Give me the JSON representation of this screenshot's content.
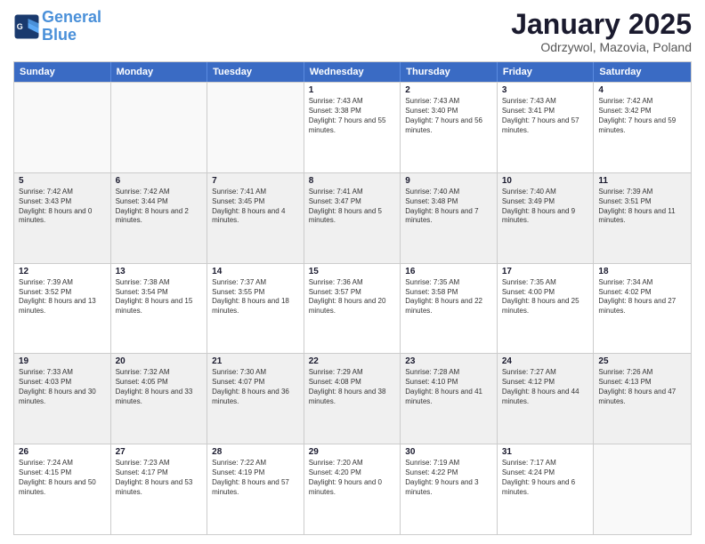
{
  "header": {
    "logo_line1": "General",
    "logo_line2": "Blue",
    "month_title": "January 2025",
    "location": "Odrzywol, Mazovia, Poland"
  },
  "days_of_week": [
    "Sunday",
    "Monday",
    "Tuesday",
    "Wednesday",
    "Thursday",
    "Friday",
    "Saturday"
  ],
  "rows": [
    [
      {
        "day": "",
        "empty": true
      },
      {
        "day": "",
        "empty": true
      },
      {
        "day": "",
        "empty": true
      },
      {
        "day": "1",
        "sunrise": "7:43 AM",
        "sunset": "3:38 PM",
        "daylight": "7 hours and 55 minutes."
      },
      {
        "day": "2",
        "sunrise": "7:43 AM",
        "sunset": "3:40 PM",
        "daylight": "7 hours and 56 minutes."
      },
      {
        "day": "3",
        "sunrise": "7:43 AM",
        "sunset": "3:41 PM",
        "daylight": "7 hours and 57 minutes."
      },
      {
        "day": "4",
        "sunrise": "7:42 AM",
        "sunset": "3:42 PM",
        "daylight": "7 hours and 59 minutes."
      }
    ],
    [
      {
        "day": "5",
        "sunrise": "7:42 AM",
        "sunset": "3:43 PM",
        "daylight": "8 hours and 0 minutes."
      },
      {
        "day": "6",
        "sunrise": "7:42 AM",
        "sunset": "3:44 PM",
        "daylight": "8 hours and 2 minutes."
      },
      {
        "day": "7",
        "sunrise": "7:41 AM",
        "sunset": "3:45 PM",
        "daylight": "8 hours and 4 minutes."
      },
      {
        "day": "8",
        "sunrise": "7:41 AM",
        "sunset": "3:47 PM",
        "daylight": "8 hours and 5 minutes."
      },
      {
        "day": "9",
        "sunrise": "7:40 AM",
        "sunset": "3:48 PM",
        "daylight": "8 hours and 7 minutes."
      },
      {
        "day": "10",
        "sunrise": "7:40 AM",
        "sunset": "3:49 PM",
        "daylight": "8 hours and 9 minutes."
      },
      {
        "day": "11",
        "sunrise": "7:39 AM",
        "sunset": "3:51 PM",
        "daylight": "8 hours and 11 minutes."
      }
    ],
    [
      {
        "day": "12",
        "sunrise": "7:39 AM",
        "sunset": "3:52 PM",
        "daylight": "8 hours and 13 minutes."
      },
      {
        "day": "13",
        "sunrise": "7:38 AM",
        "sunset": "3:54 PM",
        "daylight": "8 hours and 15 minutes."
      },
      {
        "day": "14",
        "sunrise": "7:37 AM",
        "sunset": "3:55 PM",
        "daylight": "8 hours and 18 minutes."
      },
      {
        "day": "15",
        "sunrise": "7:36 AM",
        "sunset": "3:57 PM",
        "daylight": "8 hours and 20 minutes."
      },
      {
        "day": "16",
        "sunrise": "7:35 AM",
        "sunset": "3:58 PM",
        "daylight": "8 hours and 22 minutes."
      },
      {
        "day": "17",
        "sunrise": "7:35 AM",
        "sunset": "4:00 PM",
        "daylight": "8 hours and 25 minutes."
      },
      {
        "day": "18",
        "sunrise": "7:34 AM",
        "sunset": "4:02 PM",
        "daylight": "8 hours and 27 minutes."
      }
    ],
    [
      {
        "day": "19",
        "sunrise": "7:33 AM",
        "sunset": "4:03 PM",
        "daylight": "8 hours and 30 minutes."
      },
      {
        "day": "20",
        "sunrise": "7:32 AM",
        "sunset": "4:05 PM",
        "daylight": "8 hours and 33 minutes."
      },
      {
        "day": "21",
        "sunrise": "7:30 AM",
        "sunset": "4:07 PM",
        "daylight": "8 hours and 36 minutes."
      },
      {
        "day": "22",
        "sunrise": "7:29 AM",
        "sunset": "4:08 PM",
        "daylight": "8 hours and 38 minutes."
      },
      {
        "day": "23",
        "sunrise": "7:28 AM",
        "sunset": "4:10 PM",
        "daylight": "8 hours and 41 minutes."
      },
      {
        "day": "24",
        "sunrise": "7:27 AM",
        "sunset": "4:12 PM",
        "daylight": "8 hours and 44 minutes."
      },
      {
        "day": "25",
        "sunrise": "7:26 AM",
        "sunset": "4:13 PM",
        "daylight": "8 hours and 47 minutes."
      }
    ],
    [
      {
        "day": "26",
        "sunrise": "7:24 AM",
        "sunset": "4:15 PM",
        "daylight": "8 hours and 50 minutes."
      },
      {
        "day": "27",
        "sunrise": "7:23 AM",
        "sunset": "4:17 PM",
        "daylight": "8 hours and 53 minutes."
      },
      {
        "day": "28",
        "sunrise": "7:22 AM",
        "sunset": "4:19 PM",
        "daylight": "8 hours and 57 minutes."
      },
      {
        "day": "29",
        "sunrise": "7:20 AM",
        "sunset": "4:20 PM",
        "daylight": "9 hours and 0 minutes."
      },
      {
        "day": "30",
        "sunrise": "7:19 AM",
        "sunset": "4:22 PM",
        "daylight": "9 hours and 3 minutes."
      },
      {
        "day": "31",
        "sunrise": "7:17 AM",
        "sunset": "4:24 PM",
        "daylight": "9 hours and 6 minutes."
      },
      {
        "day": "",
        "empty": true
      }
    ]
  ]
}
